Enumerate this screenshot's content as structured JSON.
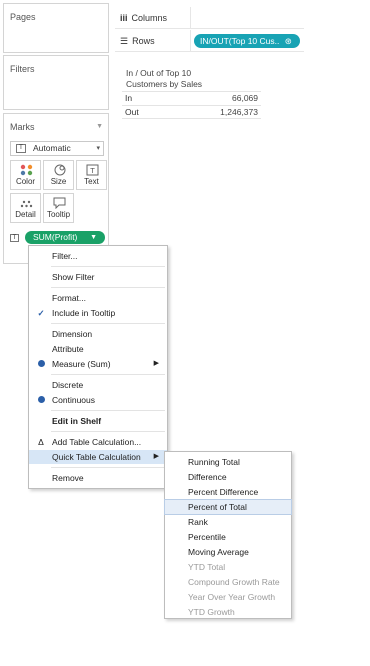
{
  "panels": {
    "pages_title": "Pages",
    "filters_title": "Filters",
    "marks_title": "Marks"
  },
  "marks": {
    "type_value": "Automatic",
    "buttons": [
      {
        "label": "Color",
        "icon": "color-dots-icon"
      },
      {
        "label": "Size",
        "icon": "size-icon"
      },
      {
        "label": "Text",
        "icon": "text-icon"
      },
      {
        "label": "Detail",
        "icon": "detail-icon"
      },
      {
        "label": "Tooltip",
        "icon": "tooltip-icon"
      }
    ],
    "pill_label": "SUM(Profit)"
  },
  "shelves": {
    "columns_label": "Columns",
    "rows_label": "Rows",
    "rows_pill": "IN/OUT(Top 10 Cus.."
  },
  "view": {
    "title_line1": "In / Out of Top 10",
    "title_line2": "Customers by Sales",
    "rows": [
      {
        "key": "In",
        "value": "66,069"
      },
      {
        "key": "Out",
        "value": "1,246,373"
      }
    ]
  },
  "context_menu": {
    "items": [
      "Filter...",
      "Show Filter",
      "Format...",
      "Include in Tooltip",
      "Dimension",
      "Attribute",
      "Measure (Sum)",
      "Discrete",
      "Continuous",
      "Edit in Shelf",
      "Add Table Calculation...",
      "Quick Table Calculation",
      "Remove"
    ]
  },
  "submenu": {
    "items": [
      "Running Total",
      "Difference",
      "Percent Difference",
      "Percent of Total",
      "Rank",
      "Percentile",
      "Moving Average",
      "YTD Total",
      "Compound Growth Rate",
      "Year Over Year Growth",
      "YTD Growth"
    ]
  }
}
